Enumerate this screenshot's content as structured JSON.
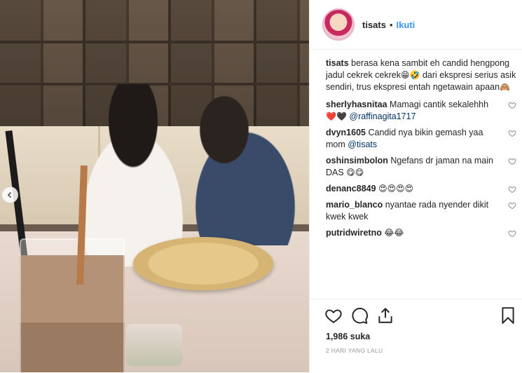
{
  "post": {
    "author": "tisats",
    "separator": "•",
    "follow_label": "Ikuti",
    "likes_text": "1,986 suka",
    "timestamp": "2 HARI YANG LALU"
  },
  "caption": {
    "user": "tisats",
    "text": "berasa kena sambit eh candid hengpong jadul cekrek cekrek",
    "emoji1": "😁🤣",
    "text2": "dari ekspresi serius asik sendiri, trus ekspresi entah ngetawain apaan",
    "emoji2": "🙈"
  },
  "comments": [
    {
      "user": "sherlyhasnitaa",
      "text": "Mamagi cantik sekalehhh",
      "emoji": "❤️🖤",
      "mention": "@raffinagita1717"
    },
    {
      "user": "dvyn1605",
      "text": "Candid nya bikin gemash yaa mom",
      "mention": "@tisats"
    },
    {
      "user": "oshinsimbolon",
      "text": "Ngefans dr jaman na main DAS",
      "emoji": "😋😋"
    },
    {
      "user": "denanc8849",
      "emoji": "😍😍😍😍"
    },
    {
      "user": "mario_blanco",
      "text": "nyantae rada nyender dikit kwek kwek"
    },
    {
      "user": "putridwiretno",
      "emoji": "😂😂"
    }
  ],
  "icons": {
    "prev": "chevron-left-icon",
    "like": "heart-icon",
    "comment": "comment-icon",
    "share": "share-icon",
    "save": "bookmark-icon"
  },
  "colors": {
    "follow": "#3897f0",
    "mention": "#003569",
    "meta": "#999999"
  }
}
